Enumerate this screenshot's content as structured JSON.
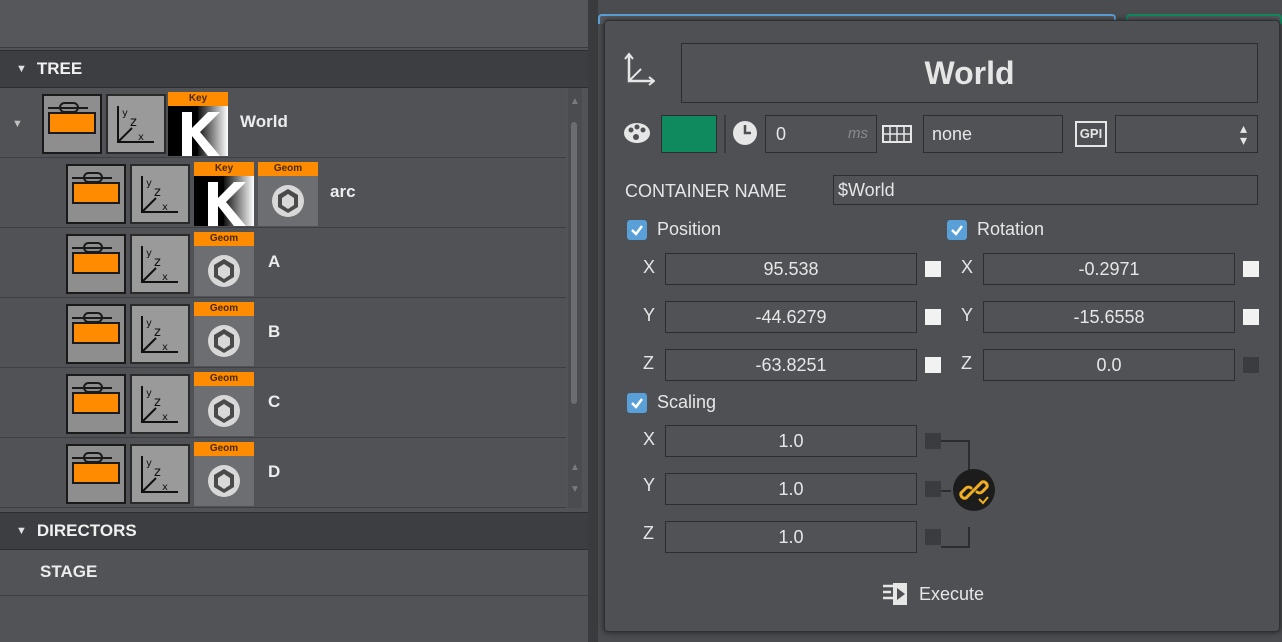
{
  "tree": {
    "header": "TREE",
    "rows": [
      {
        "label": "World",
        "plugins": [
          "Key"
        ]
      },
      {
        "label": "arc",
        "plugins": [
          "Key",
          "Geom"
        ]
      },
      {
        "label": "A",
        "plugins": [
          "Geom"
        ]
      },
      {
        "label": "B",
        "plugins": [
          "Geom"
        ]
      },
      {
        "label": "C",
        "plugins": [
          "Geom"
        ]
      },
      {
        "label": "D",
        "plugins": [
          "Geom"
        ]
      }
    ],
    "key_tag": "Key",
    "geom_tag": "Geom"
  },
  "directors": {
    "header": "DIRECTORS",
    "stage_label": "STAGE"
  },
  "panel": {
    "title": "World",
    "color_swatch": "#0f8a5f",
    "delay_value": "0",
    "delay_unit": "ms",
    "key_value": "none",
    "gpi_label": "GPI",
    "container_name_label": "CONTAINER NAME",
    "container_name_value": "$World",
    "position": {
      "label": "Position",
      "x": "95.538",
      "y": "-44.6279",
      "z": "-63.8251"
    },
    "rotation": {
      "label": "Rotation",
      "x": "-0.2971",
      "y": "-15.6558",
      "z": "0.0"
    },
    "scaling": {
      "label": "Scaling",
      "x": "1.0",
      "y": "1.0",
      "z": "1.0"
    },
    "axis_x": "X",
    "axis_y": "Y",
    "axis_z": "Z",
    "execute_label": "Execute"
  },
  "colors": {
    "accent_orange": "#ff8c00",
    "checkbox_blue": "#5aa0d8",
    "link_gold": "#f0b020"
  }
}
